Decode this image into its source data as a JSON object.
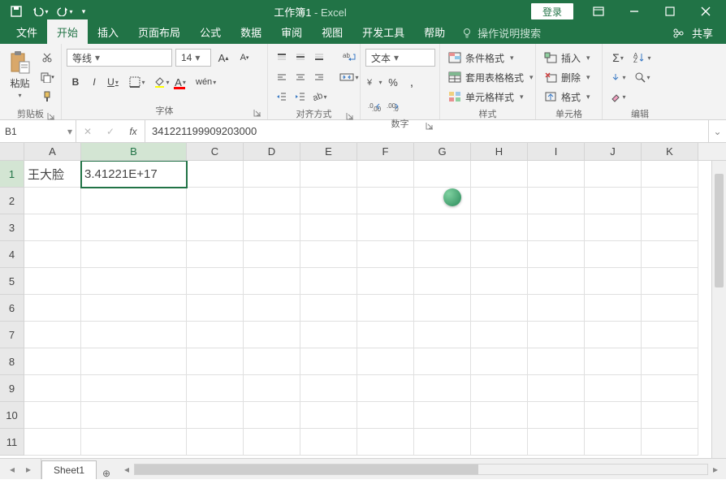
{
  "titlebar": {
    "doc_title": "工作簿1",
    "app_sep": " - ",
    "app_name": "Excel",
    "login": "登录"
  },
  "tabs": {
    "file": "文件",
    "home": "开始",
    "insert": "插入",
    "page_layout": "页面布局",
    "formulas": "公式",
    "data": "数据",
    "review": "审阅",
    "view": "视图",
    "developer": "开发工具",
    "help": "帮助",
    "tellme": "操作说明搜索",
    "share": "共享"
  },
  "ribbon": {
    "clipboard": {
      "paste": "粘贴",
      "group": "剪贴板"
    },
    "font": {
      "name": "等线",
      "size": "14",
      "group": "字体"
    },
    "alignment": {
      "group": "对齐方式"
    },
    "number": {
      "format": "文本",
      "group": "数字"
    },
    "styles": {
      "cond": "条件格式",
      "table": "套用表格格式",
      "cell": "单元格样式",
      "group": "样式"
    },
    "cells": {
      "insert": "插入",
      "delete": "删除",
      "format": "格式",
      "group": "单元格"
    },
    "editing": {
      "group": "编辑"
    }
  },
  "formula_bar": {
    "name_box": "B1",
    "value": "341221199909203000"
  },
  "grid": {
    "columns": [
      "A",
      "B",
      "C",
      "D",
      "E",
      "F",
      "G",
      "H",
      "I",
      "J",
      "K"
    ],
    "rows": [
      1,
      2,
      3,
      4,
      5,
      6,
      7,
      8,
      9,
      10,
      11
    ],
    "cells": {
      "A1": "王大脸",
      "B1": "3.41221E+17"
    },
    "selected": "B1",
    "active_row": 1,
    "active_col": "B"
  },
  "sheets": {
    "tab1": "Sheet1"
  }
}
